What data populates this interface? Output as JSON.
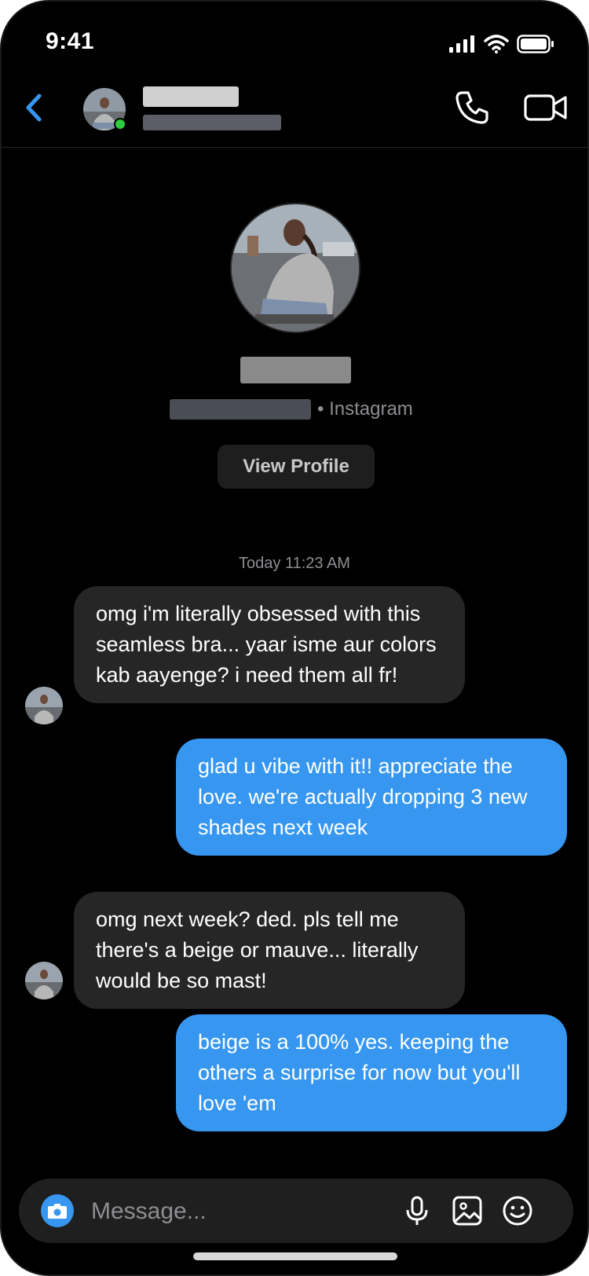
{
  "status_bar": {
    "time": "9:41"
  },
  "header": {
    "back_icon": "chevron-left-icon",
    "call_icon": "phone-icon",
    "video_icon": "video-camera-icon",
    "online": true
  },
  "profile": {
    "platform": "• Instagram",
    "view_profile_label": "View Profile"
  },
  "thread": {
    "timestamp": "Today 11:23 AM",
    "messages": [
      {
        "direction": "incoming",
        "text": "omg i'm literally obsessed with this seamless bra... yaar isme aur colors kab aayenge? i need them all fr!"
      },
      {
        "direction": "outgoing",
        "text": "glad u vibe with it!! appreciate the love. we're actually dropping 3 new shades next week"
      },
      {
        "direction": "incoming",
        "text": "omg next week? ded. pls tell me there's a beige or mauve... literally would be so mast!"
      },
      {
        "direction": "outgoing",
        "text": "beige is a 100% yes. keeping the others a surprise for now but you'll love 'em"
      }
    ]
  },
  "composer": {
    "placeholder": "Message...",
    "camera_icon": "camera-icon",
    "mic_icon": "microphone-icon",
    "gallery_icon": "image-icon",
    "sticker_icon": "smiley-icon"
  },
  "colors": {
    "background": "#000000",
    "incoming_bubble": "#262626",
    "outgoing_bubble": "#3797f0",
    "accent": "#3797f0",
    "online_dot": "#2ecc40"
  }
}
